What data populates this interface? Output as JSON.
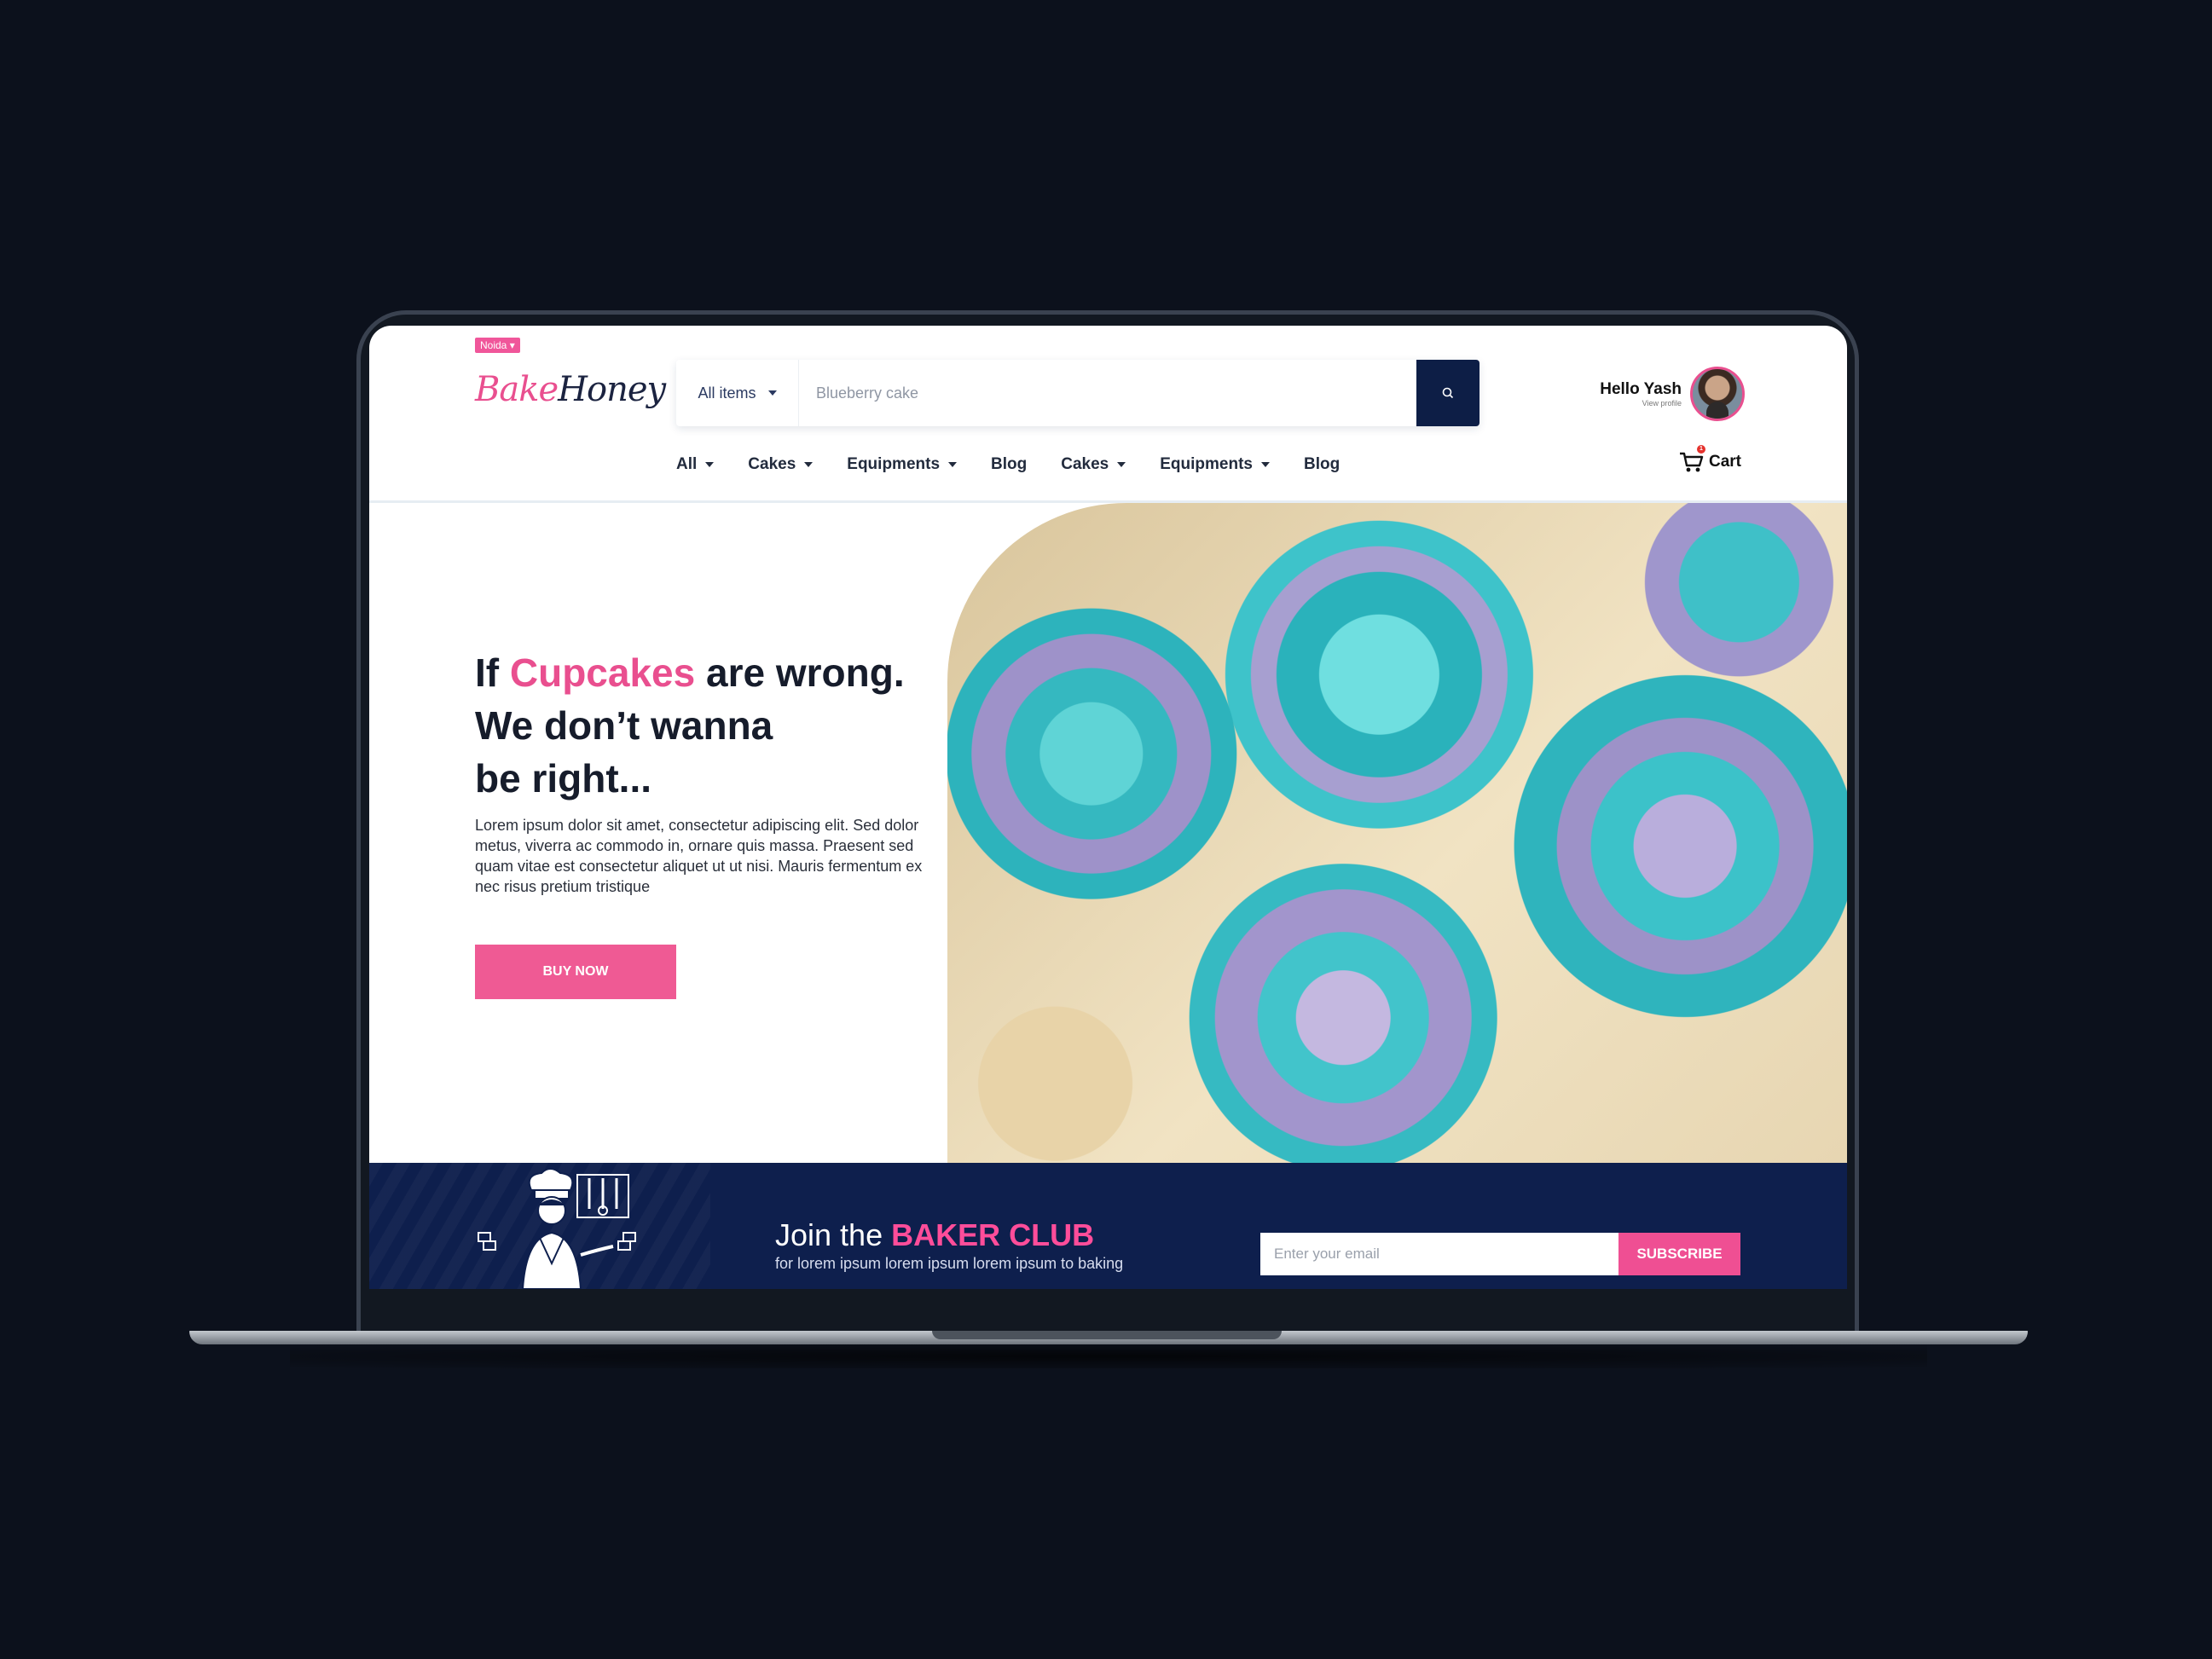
{
  "header": {
    "location": "Noida",
    "logo": {
      "part1": "Bake",
      "part2": "Honey"
    },
    "search": {
      "category": "All items",
      "placeholder": "Blueberry cake"
    },
    "user": {
      "greeting": "Hello Yash",
      "sub": "View profile"
    },
    "cart": {
      "label": "Cart",
      "count": "1"
    }
  },
  "nav": {
    "items": [
      {
        "label": "All",
        "dropdown": true
      },
      {
        "label": "Cakes",
        "dropdown": true
      },
      {
        "label": "Equipments",
        "dropdown": true
      },
      {
        "label": "Blog",
        "dropdown": false
      },
      {
        "label": "Cakes",
        "dropdown": true
      },
      {
        "label": "Equipments",
        "dropdown": true
      },
      {
        "label": "Blog",
        "dropdown": false
      }
    ]
  },
  "hero": {
    "heading_pre": "If ",
    "heading_accent": "Cupcakes",
    "heading_post1": " are wrong.",
    "heading_line2": "We don’t wanna",
    "heading_line3": "be right...",
    "description": "Lorem ipsum dolor sit amet, consectetur adipiscing elit. Sed dolor metus, viverra ac commodo in, ornare quis massa. Praesent sed quam vitae est consectetur aliquet ut ut nisi. Mauris fermentum ex nec risus pretium tristique",
    "cta": "BUY NOW"
  },
  "newsletter": {
    "title_pre": "Join the ",
    "title_accent": "BAKER CLUB",
    "subtitle": "for lorem ipsum lorem ipsum lorem ipsum to baking",
    "email_placeholder": "Enter your email",
    "subscribe": "SUBSCRIBE"
  },
  "colors": {
    "accent_pink": "#ef5a94",
    "navy": "#0e1f4d",
    "background": "#0c111c"
  }
}
